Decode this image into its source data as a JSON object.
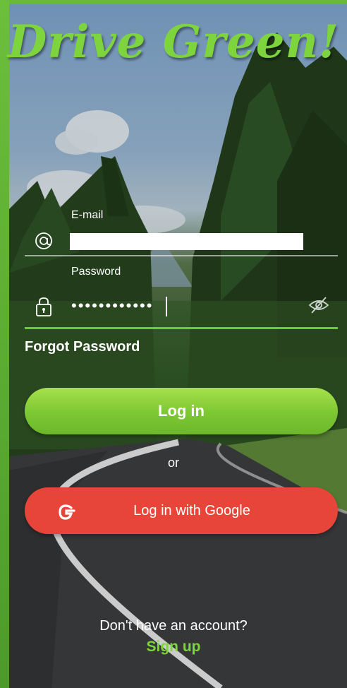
{
  "app": {
    "logo_text": "Drive Green!"
  },
  "login_form": {
    "email_label": "E-mail",
    "email_value": "",
    "password_label": "Password",
    "password_masked": "••••••••••••",
    "forgot_password": "Forgot Password",
    "login_button": "Log in",
    "or_text": "or",
    "google_button": "Log in with Google"
  },
  "footer": {
    "no_account_text": "Don't have an account?",
    "signup_link": "Sign up"
  },
  "colors": {
    "brand_green": "#7ed43c",
    "google_red": "#e8453a",
    "frame_green": "#5aa531"
  },
  "icons": {
    "email": "at-icon",
    "password": "lock-icon",
    "toggle": "eye-hidden-icon",
    "google": "google-g-icon"
  }
}
